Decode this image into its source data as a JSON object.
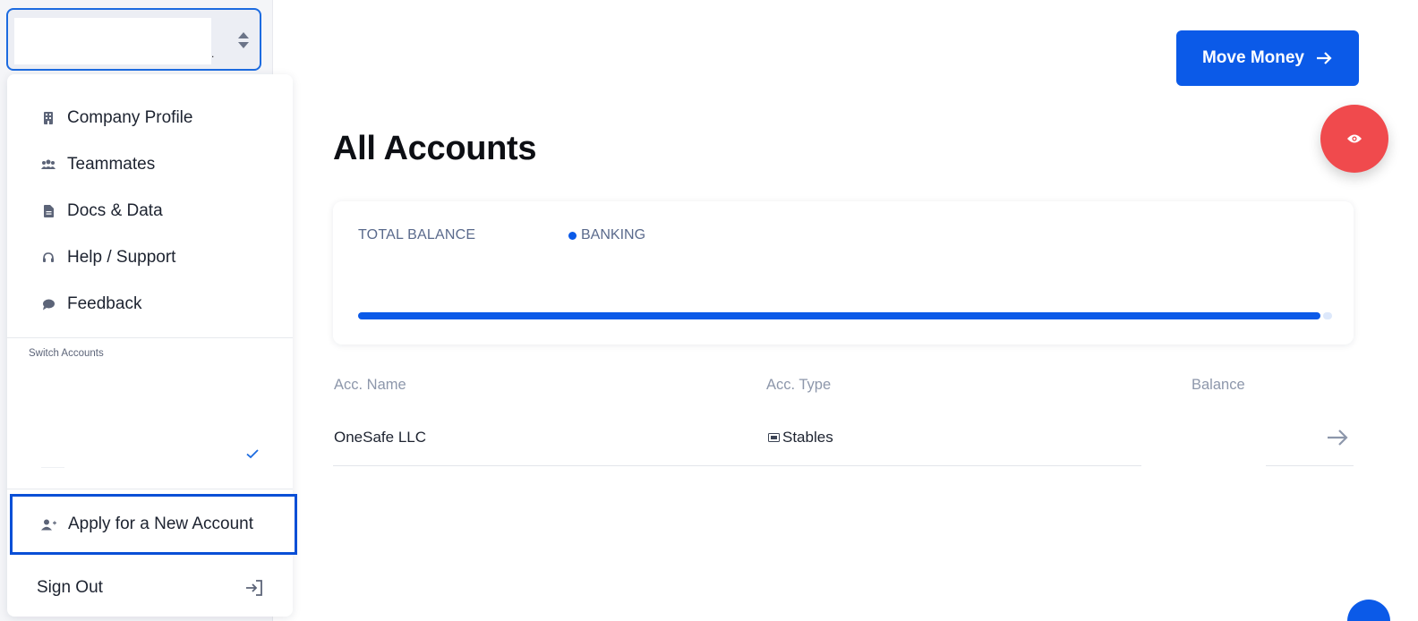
{
  "sidebar": {
    "account_selector": {
      "dot": "."
    }
  },
  "menu": {
    "items": [
      {
        "label": "Company Profile",
        "icon": "building-icon"
      },
      {
        "label": "Teammates",
        "icon": "users-icon"
      },
      {
        "label": "Docs & Data",
        "icon": "document-icon"
      },
      {
        "label": "Help / Support",
        "icon": "headset-icon"
      },
      {
        "label": "Feedback",
        "icon": "chat-bubble-icon"
      }
    ],
    "switch_accounts_label": "Switch Accounts",
    "apply_label": "Apply for a New Account",
    "sign_out_label": "Sign Out"
  },
  "header": {
    "move_money_label": "Move Money"
  },
  "main": {
    "title": "All Accounts",
    "balance_card": {
      "total_label": "TOTAL BALANCE",
      "legend_label": "BANKING",
      "banking_fraction": 0.99
    },
    "table": {
      "columns": [
        "Acc. Name",
        "Acc. Type",
        "Balance"
      ],
      "rows": [
        {
          "name": "OneSafe LLC",
          "type": "Stables",
          "balance": ""
        }
      ]
    }
  },
  "colors": {
    "accent": "#0b5ae8",
    "eye_button": "#f04a4d",
    "focus_border": "#0a4fd6"
  }
}
